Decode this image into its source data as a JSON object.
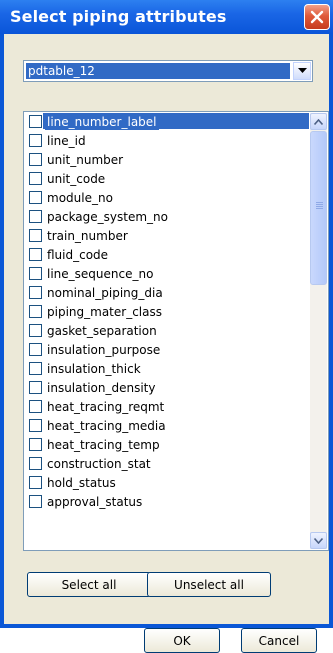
{
  "window": {
    "title": "Select piping attributes"
  },
  "dropdown": {
    "selected": "pdtable_12"
  },
  "attributes": [
    "line_number_label",
    "line_id",
    "unit_number",
    "unit_code",
    "module_no",
    "package_system_no",
    "train_number",
    "fluid_code",
    "line_sequence_no",
    "nominal_piping_dia",
    "piping_mater_class",
    "gasket_separation",
    "insulation_purpose",
    "insulation_thick",
    "insulation_density",
    "heat_tracing_reqmt",
    "heat_tracing_media",
    "heat_tracing_temp",
    "construction_stat",
    "hold_status",
    "approval_status"
  ],
  "selected_index": 0,
  "buttons": {
    "select_all": "Select all",
    "unselect_all": "Unselect all",
    "ok": "OK",
    "cancel": "Cancel"
  },
  "colors": {
    "selection": "#316ac5",
    "titlebar": "#0a55d8",
    "dialog_bg": "#ece9d8"
  }
}
